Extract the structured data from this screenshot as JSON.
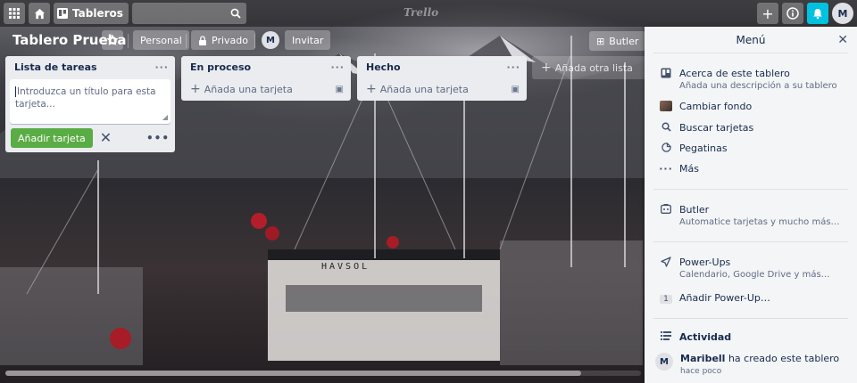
{
  "topbar": {
    "apps_icon": "grid-icon",
    "home_icon": "home-icon",
    "boards_label": "Tableros",
    "search_placeholder": "",
    "brand": "Trello"
  },
  "board": {
    "title": "Tablero Prueba",
    "star_icon": "star-icon",
    "team_label": "Personal",
    "visibility_label": "Privado",
    "member_initial": "M",
    "invite_label": "Invitar",
    "butler_label": "Butler"
  },
  "lists": [
    {
      "title": "Lista de tareas",
      "composer_placeholder": "Introduzca un título para esta tarjeta...",
      "add_button": "Añadir tarjeta"
    },
    {
      "title": "En proceso",
      "add_card": "Añada una tarjeta"
    },
    {
      "title": "Hecho",
      "add_card": "Añada una tarjeta"
    }
  ],
  "add_list_label": "Añada otra lista",
  "menu": {
    "title": "Menú",
    "items": [
      {
        "label": "Acerca de este tablero",
        "sub": "Añada una descripción a su tablero",
        "icon": "board-icon"
      },
      {
        "label": "Cambiar fondo",
        "icon": "background-thumbnail"
      },
      {
        "label": "Buscar tarjetas",
        "icon": "search-icon"
      },
      {
        "label": "Pegatinas",
        "icon": "sticker-icon"
      },
      {
        "label": "Más",
        "icon": "more-icon"
      }
    ],
    "butler": {
      "label": "Butler",
      "sub": "Automatice tarjetas y mucho más…"
    },
    "powerups": {
      "label": "Power-Ups",
      "sub": "Calendario, Google Drive y más…",
      "count": "1",
      "add_label": "Añadir Power-Up…"
    },
    "activity": {
      "heading": "Actividad",
      "user": "Maribell",
      "action": "ha creado este tablero",
      "time": "hace poco",
      "initial": "M"
    }
  },
  "user_initial": "M",
  "colors": {
    "add_button": "#5aac44",
    "notification": "#00c2e0",
    "list_bg": "#ebecf0"
  }
}
